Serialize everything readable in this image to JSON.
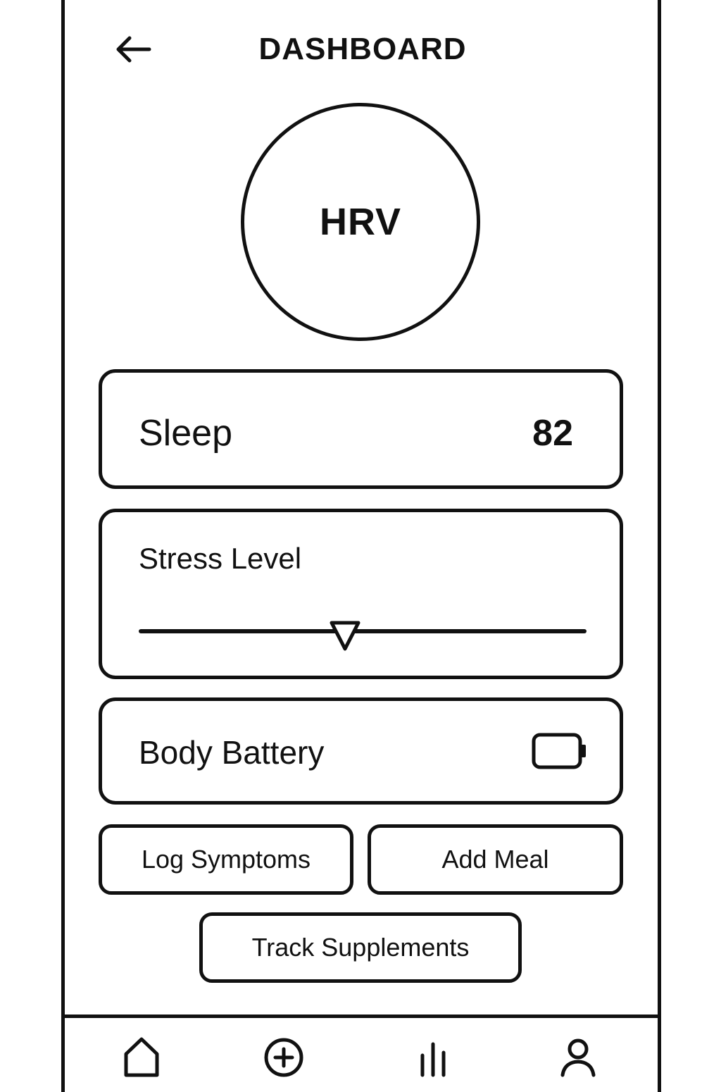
{
  "header": {
    "back_icon": "arrow-left-icon",
    "title": "DASHBOARD"
  },
  "hrv": {
    "label": "HRV"
  },
  "sleep": {
    "label": "Sleep",
    "value": "82"
  },
  "stress": {
    "label": "Stress Level",
    "level_fraction": 0.46
  },
  "body_battery": {
    "label": "Body Battery",
    "icon": "battery-icon"
  },
  "actions": {
    "log_symptoms": "Log Symptoms",
    "add_meal": "Add Meal",
    "track_supplements": "Track Supplements"
  },
  "bottom_nav": {
    "items": [
      {
        "icon": "home-icon"
      },
      {
        "icon": "plus-circle-icon"
      },
      {
        "icon": "bar-chart-icon"
      },
      {
        "icon": "user-icon"
      }
    ]
  },
  "colors": {
    "stroke": "#111111",
    "background": "#ffffff"
  }
}
